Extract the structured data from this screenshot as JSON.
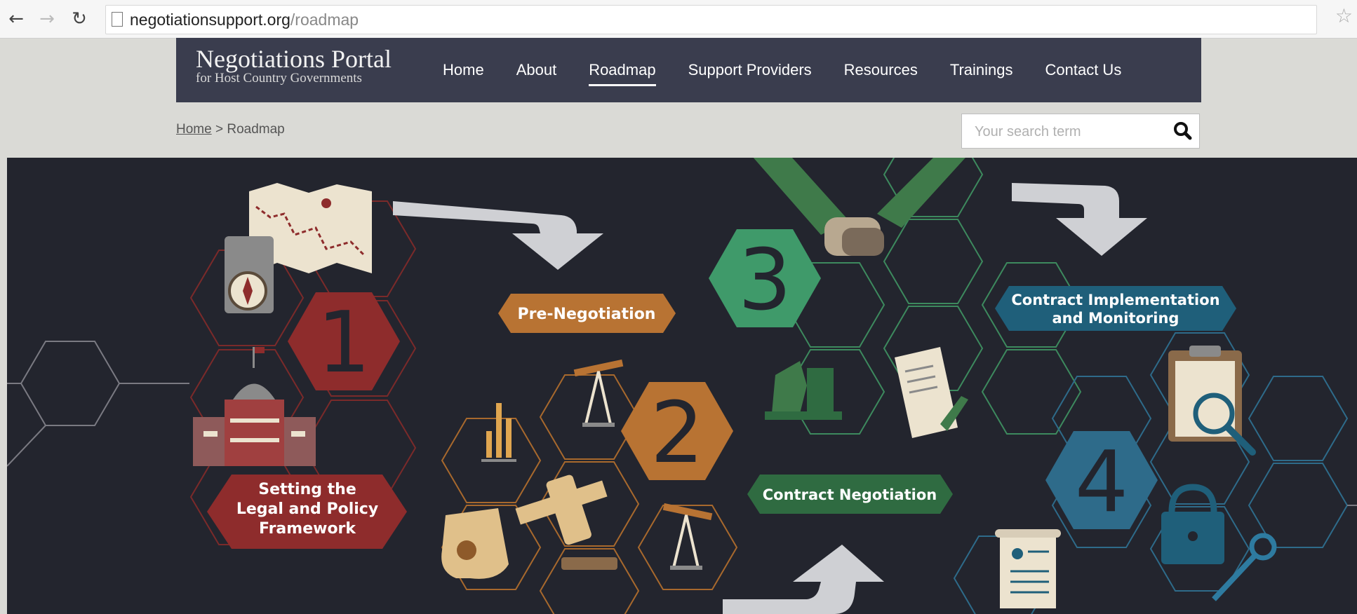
{
  "browser": {
    "url_host": "negotiationsupport.org",
    "url_path": "/roadmap",
    "back_icon": "arrow-left-icon",
    "forward_icon": "arrow-right-icon",
    "reload_icon": "reload-icon",
    "bookmark_icon": "star-icon"
  },
  "site": {
    "logo_title": "Negotiations Portal",
    "logo_subtitle": "for Host Country Governments",
    "nav": [
      {
        "label": "Home",
        "active": false
      },
      {
        "label": "About",
        "active": false
      },
      {
        "label": "Roadmap",
        "active": true
      },
      {
        "label": "Support Providers",
        "active": false
      },
      {
        "label": "Resources",
        "active": false
      },
      {
        "label": "Trainings",
        "active": false
      },
      {
        "label": "Contact Us",
        "active": false
      }
    ]
  },
  "breadcrumb": {
    "home": "Home",
    "separator": " > ",
    "current": "Roadmap"
  },
  "search": {
    "placeholder": "Your search term",
    "icon": "search-icon"
  },
  "roadmap": {
    "stages": [
      {
        "number": "1",
        "label_lines": [
          "Setting the",
          "Legal and Policy",
          "Framework"
        ],
        "color": "#8e2c2c"
      },
      {
        "number": "2",
        "label_lines": [
          "Pre-Negotiation"
        ],
        "color": "#b87333"
      },
      {
        "number": "3",
        "label_lines": [
          "Contract Negotiation"
        ],
        "color": "#3f9a6a"
      },
      {
        "number": "4",
        "label_lines": [
          "Contract Implementation",
          "and Monitoring"
        ],
        "color": "#2e6b8a"
      }
    ],
    "colors": {
      "background": "#23252e",
      "arrow": "#cfd0d4",
      "stage3_label": "#2f6b41",
      "stage4_label": "#1f5f7a"
    }
  }
}
